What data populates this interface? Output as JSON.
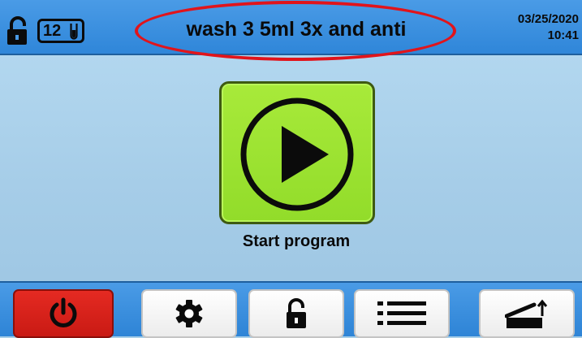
{
  "header": {
    "counter": "12",
    "program_name": "wash 3 5ml 3x and anti",
    "date": "03/25/2020",
    "time": "10:41"
  },
  "main": {
    "start_label": "Start program"
  },
  "toolbar": {
    "buttons": [
      {
        "name": "power",
        "icon": "power-icon"
      },
      {
        "name": "settings",
        "icon": "gear-icon"
      },
      {
        "name": "unlock",
        "icon": "unlock-icon"
      },
      {
        "name": "program-list",
        "icon": "list-icon"
      },
      {
        "name": "lid",
        "icon": "lid-open-icon"
      }
    ]
  },
  "colors": {
    "header_blue": "#2f86d9",
    "screen_bg": "#a9cfe8",
    "start_green": "#9ee334",
    "power_red": "#d82018",
    "highlight_red": "#e1141b"
  }
}
